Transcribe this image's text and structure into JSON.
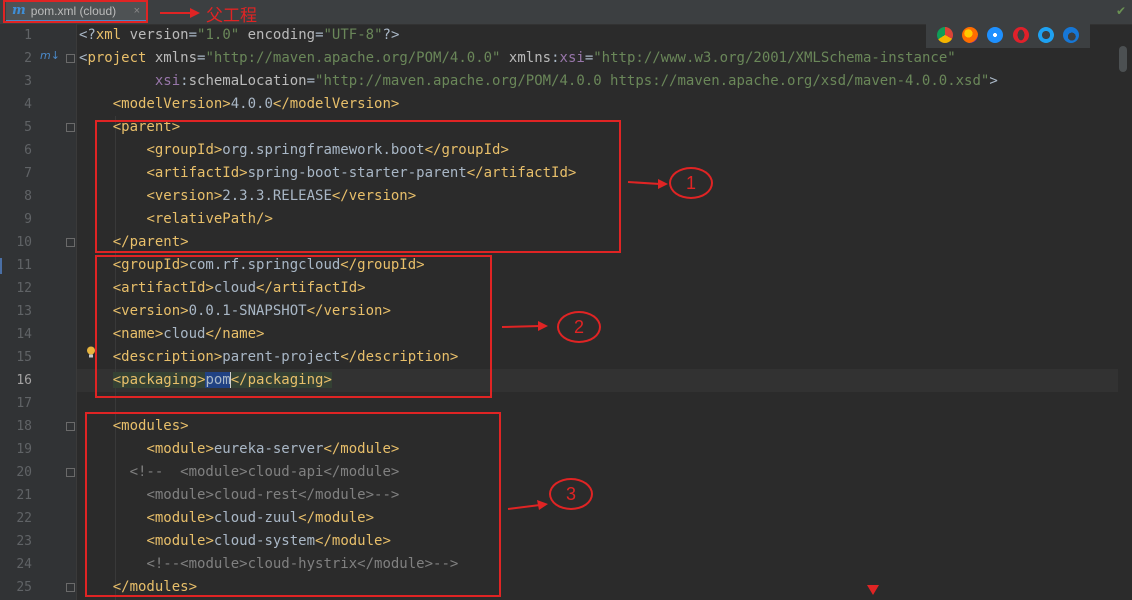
{
  "tab": {
    "icon": "m",
    "label": "pom.xml (cloud)",
    "close": "×"
  },
  "annotation_label": "父工程",
  "gutter": {
    "numbers": [
      "1",
      "2",
      "3",
      "4",
      "5",
      "6",
      "7",
      "8",
      "9",
      "10",
      "11",
      "12",
      "13",
      "14",
      "15",
      "16",
      "17",
      "18",
      "19",
      "20",
      "21",
      "22",
      "23",
      "24",
      "25"
    ],
    "current_line": 16,
    "maven_marker": "m↓"
  },
  "code_lines": [
    [
      [
        "x",
        "<?"
      ],
      [
        "t",
        "xml "
      ],
      [
        "a",
        "version"
      ],
      [
        "x",
        "="
      ],
      [
        "v",
        "\"1.0\""
      ],
      [
        "x",
        " "
      ],
      [
        "a",
        "encoding"
      ],
      [
        "x",
        "="
      ],
      [
        "v",
        "\"UTF-8\""
      ],
      [
        "x",
        "?>"
      ]
    ],
    [
      [
        "x",
        "<"
      ],
      [
        "t",
        "project "
      ],
      [
        "a",
        "xmlns"
      ],
      [
        "x",
        "="
      ],
      [
        "v",
        "\"http://maven.apache.org/POM/4.0.0\""
      ],
      [
        "x",
        " "
      ],
      [
        "a",
        "xmlns"
      ],
      [
        "x",
        ":"
      ],
      [
        "ns",
        "xsi"
      ],
      [
        "x",
        "="
      ],
      [
        "v",
        "\"http://www.w3.org/2001/XMLSchema-instance\""
      ]
    ],
    [
      [
        "x",
        "         "
      ],
      [
        "ns",
        "xsi"
      ],
      [
        "x",
        ":"
      ],
      [
        "a",
        "schemaLocation"
      ],
      [
        "x",
        "="
      ],
      [
        "v",
        "\"http://maven.apache.org/POM/4.0.0 https://maven.apache.org/xsd/maven-4.0.0.xsd\""
      ],
      [
        "x",
        ">"
      ]
    ],
    [
      [
        "x",
        "    "
      ],
      [
        "t",
        "<modelVersion>"
      ],
      [
        "x",
        "4.0.0"
      ],
      [
        "t",
        "</modelVersion>"
      ]
    ],
    [
      [
        "x",
        "    "
      ],
      [
        "t",
        "<parent>"
      ]
    ],
    [
      [
        "x",
        "        "
      ],
      [
        "t",
        "<groupId>"
      ],
      [
        "x",
        "org.springframework.boot"
      ],
      [
        "t",
        "</groupId>"
      ]
    ],
    [
      [
        "x",
        "        "
      ],
      [
        "t",
        "<artifactId>"
      ],
      [
        "x",
        "spring-boot-starter-parent"
      ],
      [
        "t",
        "</artifactId>"
      ]
    ],
    [
      [
        "x",
        "        "
      ],
      [
        "t",
        "<version>"
      ],
      [
        "x",
        "2.3.3.RELEASE"
      ],
      [
        "t",
        "</version>"
      ]
    ],
    [
      [
        "x",
        "        "
      ],
      [
        "t",
        "<relativePath/>"
      ]
    ],
    [
      [
        "x",
        "    "
      ],
      [
        "t",
        "</parent>"
      ]
    ],
    [
      [
        "x",
        "    "
      ],
      [
        "t",
        "<groupId>"
      ],
      [
        "x",
        "com.rf.springcloud"
      ],
      [
        "t",
        "</groupId>"
      ]
    ],
    [
      [
        "x",
        "    "
      ],
      [
        "t",
        "<artifactId>"
      ],
      [
        "x",
        "cloud"
      ],
      [
        "t",
        "</artifactId>"
      ]
    ],
    [
      [
        "x",
        "    "
      ],
      [
        "t",
        "<version>"
      ],
      [
        "x",
        "0.0.1-SNAPSHOT"
      ],
      [
        "t",
        "</version>"
      ]
    ],
    [
      [
        "x",
        "    "
      ],
      [
        "t",
        "<name>"
      ],
      [
        "x",
        "cloud"
      ],
      [
        "t",
        "</name>"
      ]
    ],
    [
      [
        "x",
        "    "
      ],
      [
        "t",
        "<description>"
      ],
      [
        "x",
        "parent-project"
      ],
      [
        "t",
        "</description>"
      ]
    ],
    [
      [
        "x",
        "    "
      ],
      [
        "t hl-tag",
        "<packaging>"
      ],
      [
        "x hl-sel",
        "pom"
      ],
      [
        "caret",
        ""
      ],
      [
        "t hl-tag",
        "</packaging>"
      ]
    ],
    [
      [
        "x",
        ""
      ]
    ],
    [
      [
        "x",
        "    "
      ],
      [
        "t",
        "<modules>"
      ]
    ],
    [
      [
        "x",
        "        "
      ],
      [
        "t",
        "<module>"
      ],
      [
        "x",
        "eureka-server"
      ],
      [
        "t",
        "</module>"
      ]
    ],
    [
      [
        "x",
        "      "
      ],
      [
        "c",
        "<!--  <module>cloud-api</module>"
      ]
    ],
    [
      [
        "x",
        "        "
      ],
      [
        "c",
        "<module>cloud-rest</module>-->"
      ]
    ],
    [
      [
        "x",
        "        "
      ],
      [
        "t",
        "<module>"
      ],
      [
        "x",
        "cloud-zuul"
      ],
      [
        "t",
        "</module>"
      ]
    ],
    [
      [
        "x",
        "        "
      ],
      [
        "t",
        "<module>"
      ],
      [
        "x",
        "cloud-system"
      ],
      [
        "t",
        "</module>"
      ]
    ],
    [
      [
        "x",
        "        "
      ],
      [
        "c",
        "<!--<module>cloud-hystrix</module>-->"
      ]
    ],
    [
      [
        "x",
        "    "
      ],
      [
        "t",
        "</modules>"
      ]
    ]
  ],
  "callouts": [
    {
      "number": "1"
    },
    {
      "number": "2"
    },
    {
      "number": "3"
    }
  ],
  "browser_icons": [
    "chrome-icon",
    "firefox-icon",
    "safari-icon",
    "opera-icon",
    "ie-icon",
    "edge-icon"
  ],
  "colors": {
    "annotation": "#e02424",
    "tag": "#e8bf6a",
    "attribute": "#bababa",
    "namespace": "#9876aa",
    "string": "#6a8759",
    "text": "#a9b7c6",
    "comment": "#808080",
    "background": "#2b2b2b"
  }
}
